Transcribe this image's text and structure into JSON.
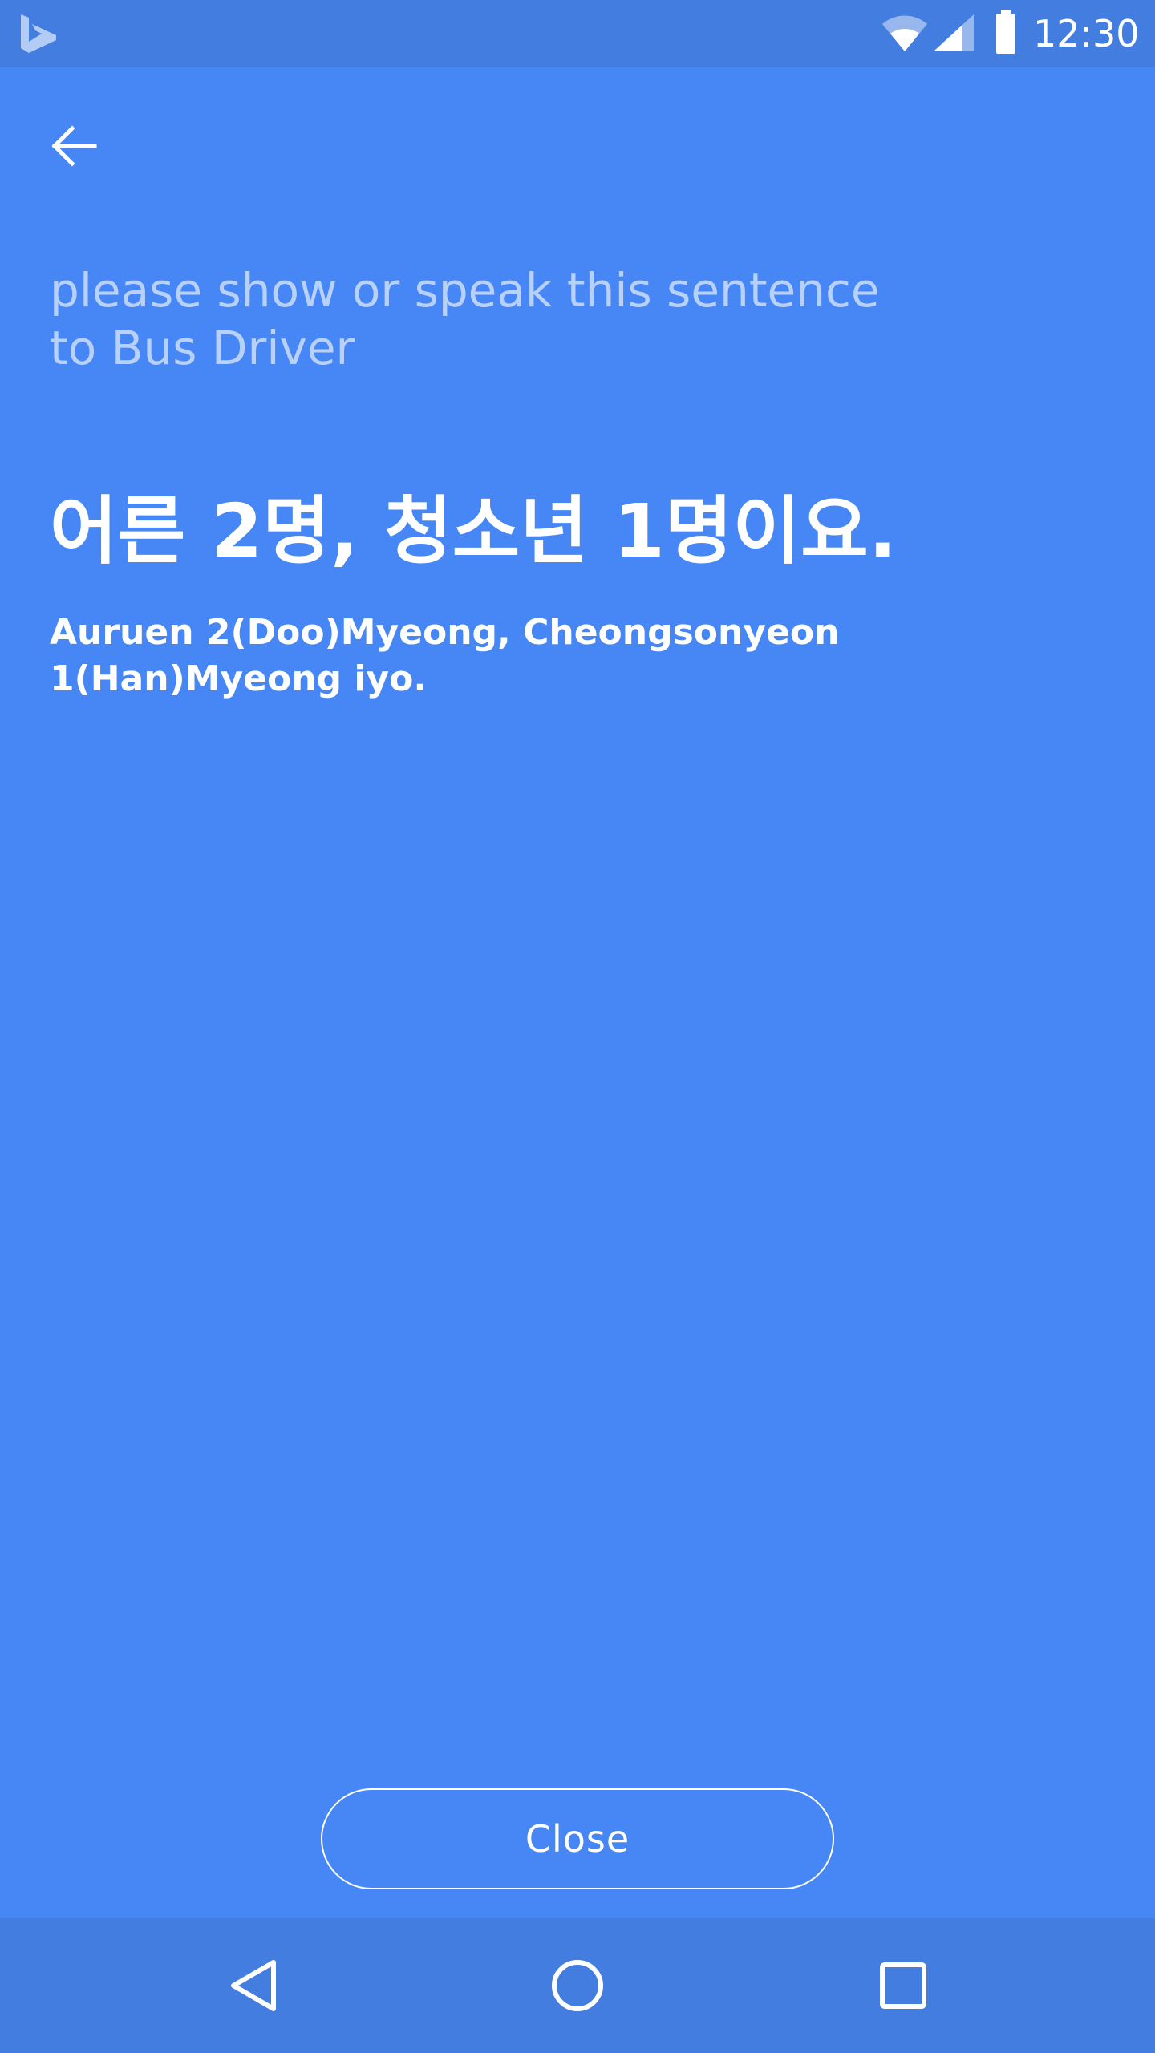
{
  "status_bar": {
    "time": "12:30",
    "icons": [
      "bing-logo-icon",
      "wifi-icon",
      "cell-signal-icon",
      "battery-icon"
    ]
  },
  "header": {
    "back_icon": "arrow-left-icon"
  },
  "content": {
    "instruction": "please show or speak this sentence\nto Bus Driver",
    "korean_phrase": "어른 2명, 청소년 1명이요.",
    "romanization": "Auruen 2(Doo)Myeong, Cheongsonyeon 1(Han)Myeong iyo."
  },
  "actions": {
    "close_label": "Close"
  },
  "nav_bar": {
    "icons": [
      "nav-back-icon",
      "nav-home-icon",
      "nav-recents-icon"
    ]
  },
  "colors": {
    "background": "#4686f5",
    "bars": "#427ddf",
    "text": "#ffffff"
  }
}
